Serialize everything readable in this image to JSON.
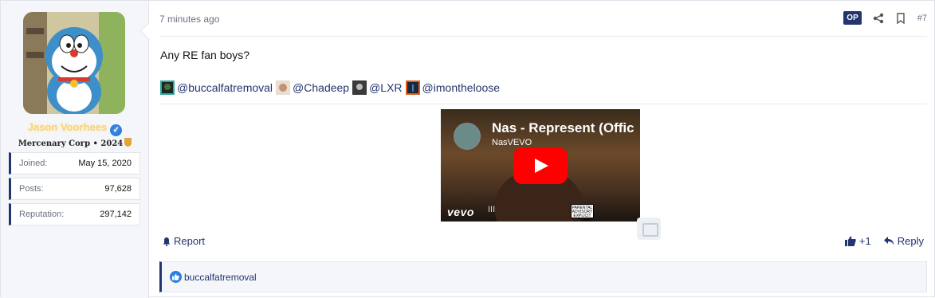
{
  "author": {
    "name": "Jason Voorhees",
    "title": "Mercenary Corp • 2024",
    "stats": [
      {
        "label": "Joined:",
        "value": "May 15, 2020"
      },
      {
        "label": "Posts:",
        "value": "97,628"
      },
      {
        "label": "Reputation:",
        "value": "297,142"
      }
    ]
  },
  "post": {
    "time": "7 minutes ago",
    "op_badge": "OP",
    "number": "#7",
    "text": "Any RE fan boys?",
    "mentions": [
      "@buccalfatremoval",
      "@Chadeep",
      "@LXR",
      "@imontheloose"
    ]
  },
  "video": {
    "title": "Nas - Represent (Offic",
    "channel": "NasVEVO",
    "logo": "vevo",
    "roman": "III",
    "advisory": "PARENTAL ADVISORY EXPLICIT CONTENT"
  },
  "actions": {
    "report": "Report",
    "like_count": "+1",
    "reply": "Reply"
  },
  "reactions": {
    "users": "buccalfatremoval"
  },
  "colors": {
    "accent": "#23356e",
    "like_blue": "#2a7de1",
    "username_gold": "#f7d27a"
  }
}
